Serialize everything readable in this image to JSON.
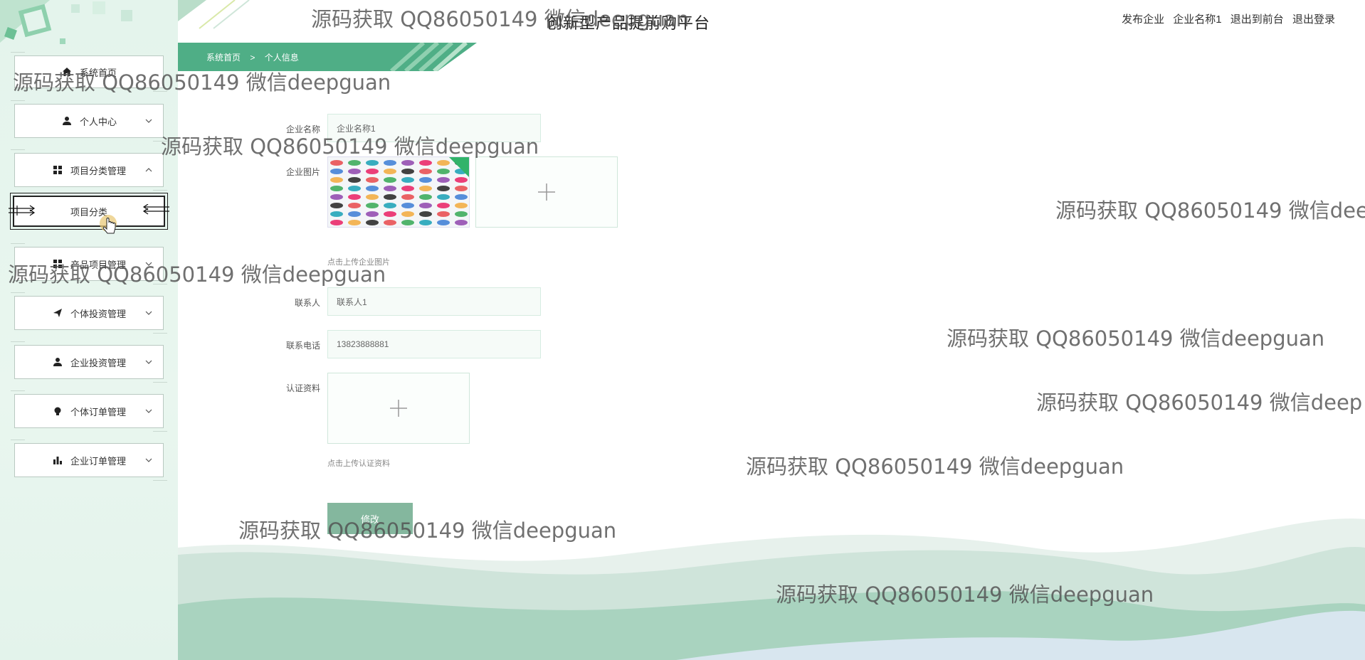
{
  "header": {
    "platform_title": "创新型产品提前购平台",
    "role": "发布企业",
    "username": "企业名称1",
    "to_frontend": "退出到前台",
    "logout": "退出登录"
  },
  "breadcrumb": {
    "home": "系统首页",
    "separator": ">",
    "current": "个人信息"
  },
  "sidebar": {
    "items": [
      {
        "label": "系统首页",
        "icon": "home-icon"
      },
      {
        "label": "个人中心",
        "icon": "user-icon"
      },
      {
        "label": "项目分类管理",
        "icon": "grid-icon",
        "expanded": true
      },
      {
        "label": "项目分类",
        "icon": "",
        "submenu": true,
        "active": true
      },
      {
        "label": "产品项目管理",
        "icon": "grid-icon"
      },
      {
        "label": "个体投资管理",
        "icon": "send-icon"
      },
      {
        "label": "企业投资管理",
        "icon": "user-icon"
      },
      {
        "label": "个体订单管理",
        "icon": "bulb-icon"
      },
      {
        "label": "企业订单管理",
        "icon": "bar-chart-icon"
      }
    ]
  },
  "form": {
    "company_name_label": "企业名称",
    "company_name_value": "企业名称1",
    "company_image_label": "企业图片",
    "company_image_hint": "点击上传企业图片",
    "contact_label": "联系人",
    "contact_value": "联系人1",
    "phone_label": "联系电话",
    "phone_value": "13823888881",
    "cert_label": "认证资料",
    "cert_hint": "点击上传认证资料",
    "submit_label": "修改"
  },
  "watermark": {
    "text": "源码获取 QQ86050149 微信deepguan",
    "text_cut_1": "源码获取 QQ86050149 微信dee",
    "text_cut_2": "源码获取 QQ86050149 微信deep"
  },
  "colors": {
    "accent": "#4fae86",
    "sidebar_bg": "#e6f5ed",
    "thumb_badge": "#31b36a",
    "submit_bg": "#84b79e"
  }
}
